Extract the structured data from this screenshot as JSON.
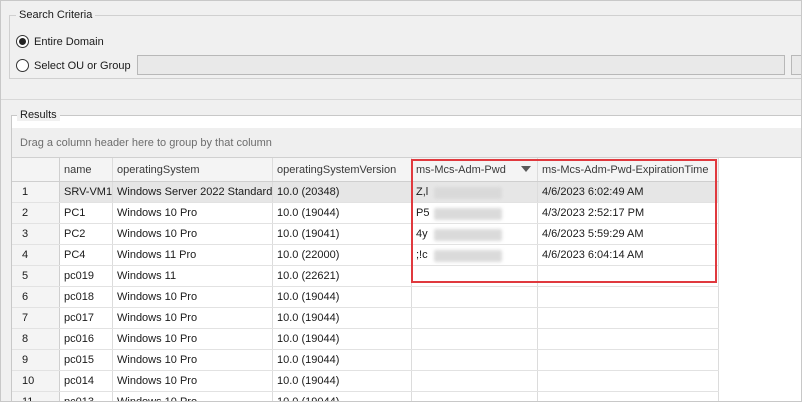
{
  "search": {
    "legend": "Search Criteria",
    "options": [
      {
        "label": "Entire Domain",
        "checked": true
      },
      {
        "label": "Select OU or Group",
        "checked": false
      }
    ],
    "ou_value": ""
  },
  "results": {
    "legend": "Results",
    "group_by_hint": "Drag a column header here to group by that column",
    "columns": [
      "name",
      "operatingSystem",
      "operatingSystemVersion",
      "ms-Mcs-Adm-Pwd",
      "ms-Mcs-Adm-Pwd-ExpirationTime"
    ],
    "sort_column": "ms-Mcs-Adm-Pwd",
    "rows": [
      {
        "num": "1",
        "name": "SRV-VM1",
        "os": "Windows Server 2022 Standard",
        "ver": "10.0 (20348)",
        "pwd": "Z,l",
        "exp": "4/6/2023 6:02:49 AM"
      },
      {
        "num": "2",
        "name": "PC1",
        "os": "Windows 10 Pro",
        "ver": "10.0 (19044)",
        "pwd": "P5",
        "exp": "4/3/2023 2:52:17 PM"
      },
      {
        "num": "3",
        "name": "PC2",
        "os": "Windows 10 Pro",
        "ver": "10.0 (19041)",
        "pwd": "4y",
        "exp": "4/6/2023 5:59:29 AM"
      },
      {
        "num": "4",
        "name": "PC4",
        "os": "Windows 11 Pro",
        "ver": "10.0 (22000)",
        "pwd": ";!c",
        "exp": "4/6/2023 6:04:14 AM"
      },
      {
        "num": "5",
        "name": "pc019",
        "os": "Windows 11",
        "ver": "10.0 (22621)",
        "pwd": "",
        "exp": ""
      },
      {
        "num": "6",
        "name": "pc018",
        "os": "Windows 10 Pro",
        "ver": "10.0 (19044)",
        "pwd": "",
        "exp": ""
      },
      {
        "num": "7",
        "name": "pc017",
        "os": "Windows 10 Pro",
        "ver": "10.0 (19044)",
        "pwd": "",
        "exp": ""
      },
      {
        "num": "8",
        "name": "pc016",
        "os": "Windows 10 Pro",
        "ver": "10.0 (19044)",
        "pwd": "",
        "exp": ""
      },
      {
        "num": "9",
        "name": "pc015",
        "os": "Windows 10 Pro",
        "ver": "10.0 (19044)",
        "pwd": "",
        "exp": ""
      },
      {
        "num": "10",
        "name": "pc014",
        "os": "Windows 10 Pro",
        "ver": "10.0 (19044)",
        "pwd": "",
        "exp": ""
      },
      {
        "num": "11",
        "name": "pc013",
        "os": "Windows 10 Pro",
        "ver": "10.0 (19044)",
        "pwd": "",
        "exp": ""
      }
    ]
  },
  "colors": {
    "highlight": "#e0393e",
    "selected_row": "#e6e6e6"
  }
}
